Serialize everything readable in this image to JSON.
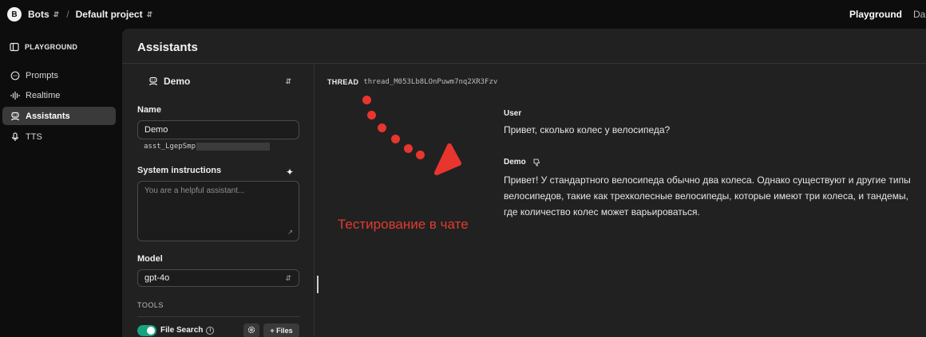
{
  "topbar": {
    "avatar_letter": "B",
    "org": "Bots",
    "separator": "/",
    "project": "Default project",
    "playground": "Playground",
    "dashboard_partial": "Da"
  },
  "nav": {
    "heading": "PLAYGROUND",
    "items": [
      {
        "label": "Prompts",
        "icon": "chat-bubble-icon"
      },
      {
        "label": "Realtime",
        "icon": "waveform-icon"
      },
      {
        "label": "Assistants",
        "icon": "robot-icon",
        "active": true
      },
      {
        "label": "TTS",
        "icon": "microphone-icon"
      }
    ]
  },
  "main": {
    "title": "Assistants"
  },
  "assistant": {
    "selected": "Demo",
    "name_label": "Name",
    "name_value": "Demo",
    "id_prefix": "asst_LgepSmp",
    "instructions_label": "System instructions",
    "instructions_placeholder": "You are a helpful assistant...",
    "model_label": "Model",
    "model_value": "gpt-4o",
    "tools_label": "TOOLS",
    "file_search_label": "File Search",
    "file_search_enabled": true,
    "files_button": "+ Files"
  },
  "thread": {
    "label": "THREAD",
    "id": "thread_M053Lb8LOnPuwm7nq2XR3Fzv",
    "messages": [
      {
        "author": "User",
        "text": "Привет, сколько колес у велосипеда?"
      },
      {
        "author": "Demo",
        "text": "Привет! У стандартного велосипеда обычно два колеса. Однако существуют и другие типы велосипедов, такие как трехколесные велосипеды, которые имеют три колеса, и тандемы, где количество колес может варьироваться."
      }
    ]
  },
  "annotation": {
    "text": "Тестирование в чате",
    "color": "#e23b30"
  },
  "colors": {
    "accent_toggle": "#16a37f",
    "panel_bg": "#212121",
    "page_bg": "#0d0d0d"
  }
}
